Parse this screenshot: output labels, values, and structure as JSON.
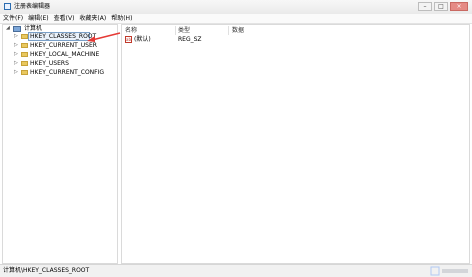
{
  "window": {
    "title": "注册表编辑器",
    "controls": [
      "–",
      "□",
      "×"
    ]
  },
  "menubar": {
    "items": [
      "文件(F)",
      "编辑(E)",
      "查看(V)",
      "收藏夹(A)",
      "帮助(H)"
    ]
  },
  "tree": {
    "root_label": "计算机",
    "children": [
      {
        "label": "HKEY_CLASSES_ROOT",
        "selected": true
      },
      {
        "label": "HKEY_CURRENT_USER"
      },
      {
        "label": "HKEY_LOCAL_MACHINE"
      },
      {
        "label": "HKEY_USERS"
      },
      {
        "label": "HKEY_CURRENT_CONFIG"
      }
    ]
  },
  "list": {
    "headers": {
      "name": "名称",
      "type": "类型",
      "data": "数据"
    },
    "rows": [
      {
        "name": "(默认)",
        "type": "REG_SZ",
        "data": ""
      }
    ]
  },
  "status": {
    "path": "计算机\\HKEY_CLASSES_ROOT"
  },
  "colors": {
    "selection": "#eaf2fb",
    "annotation_arrow": "#e53935",
    "folder": "#e9c85f"
  }
}
